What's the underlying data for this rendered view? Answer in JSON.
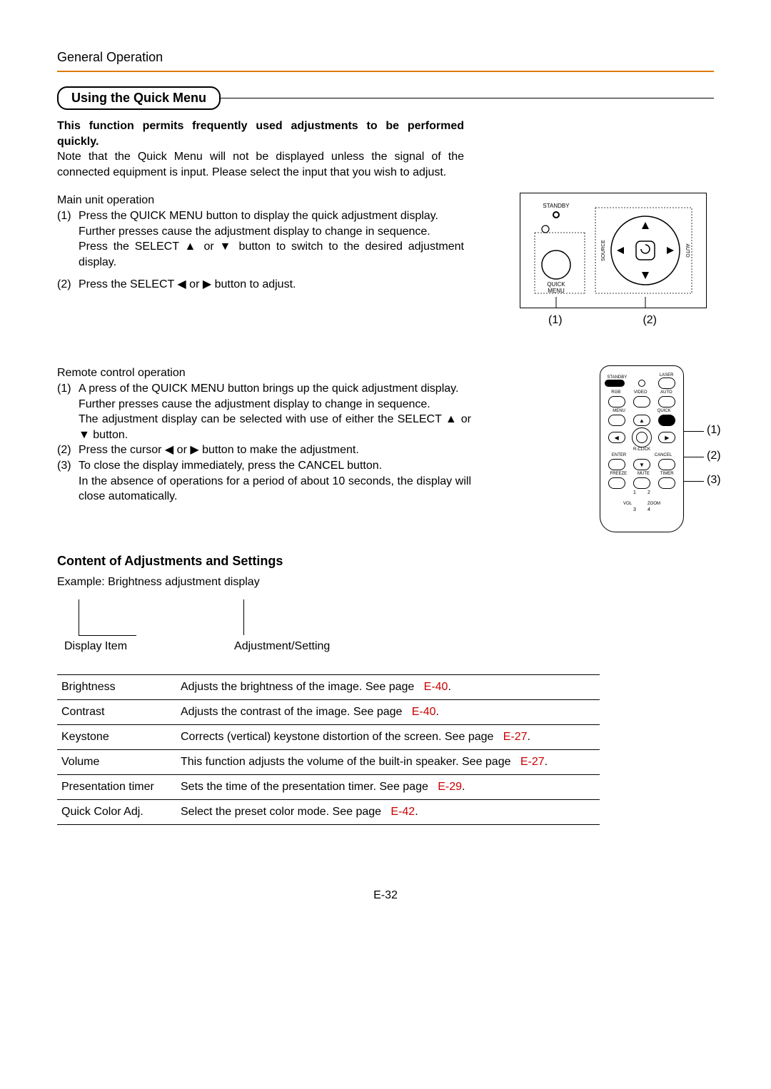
{
  "header": {
    "title": "General Operation"
  },
  "section": {
    "title": "Using the Quick Menu"
  },
  "intro": {
    "bold": "This function permits frequently used adjustments to be performed quickly.",
    "note": "Note that the Quick Menu will not be displayed unless the signal of the connected equipment is input. Please select the input that you wish to adjust."
  },
  "mainUnit": {
    "heading": "Main unit operation",
    "item1_num": "(1)",
    "item1a": "Press the QUICK MENU button to display the quick adjustment display.",
    "item1b": "Further presses cause the adjustment display to change in sequence.",
    "item1c": "Press the SELECT ▲ or ▼ button to switch to the desired adjustment display.",
    "item2_num": "(2)",
    "item2": "Press the SELECT  ◀ or ▶ button to adjust.",
    "legend1": "(1)",
    "legend2": "(2)"
  },
  "unitDiag": {
    "standby": "STANDBY",
    "quick": "QUICK",
    "menu": "MENU",
    "source": "SOURCE",
    "auto": "AUTO"
  },
  "remoteOp": {
    "heading": "Remote control operation",
    "item1_num": "(1)",
    "item1a": "A press of the QUICK MENU button brings up the quick adjustment display.",
    "item1b": "Further presses cause the adjustment display to change in sequence.",
    "item1c": "The adjustment display can be selected with use of either the SELECT ▲ or ▼ button.",
    "item2_num": "(2)",
    "item2": "Press the cursor   ◀ or ▶ button to make the adjustment.",
    "item3_num": "(3)",
    "item3a": "To close the display immediately, press the CANCEL button.",
    "item3b": "In the absence of operations for a period of about 10 seconds, the display will close automatically.",
    "mark1": "(1)",
    "mark2": "(2)",
    "mark3": "(3)"
  },
  "remoteLabels": {
    "standby": "STANDBY",
    "laser": "LASER",
    "rgb": "RGB",
    "video": "VIDEO",
    "auto": "AUTO",
    "menu": "MENU",
    "quick": "QUICK",
    "rclick": "R-CLICK",
    "enter": "ENTER",
    "cancel": "CANCEL",
    "freeze": "FREEZE",
    "mute": "MUTE",
    "timer": "TIMER",
    "vol": "VOL",
    "zoom": "ZOOM",
    "n1": "1",
    "n2": "2",
    "n3": "3",
    "n4": "4"
  },
  "content": {
    "heading": "Content of Adjustments and Settings",
    "example": "Example: Brightness adjustment display",
    "displayItem": "Display Item",
    "adjSetting": "Adjustment/Setting"
  },
  "table": {
    "r1i": "Brightness",
    "r1d": "Adjusts the brightness of the image. See page ",
    "r1p": "E-40",
    "r1s": ".",
    "r2i": "Contrast",
    "r2d": "Adjusts the contrast of the image. See page ",
    "r2p": "E-40",
    "r2s": ".",
    "r3i": "Keystone",
    "r3d": "Corrects (vertical) keystone distortion of the screen.  See page ",
    "r3p": "E-27",
    "r3s": ".",
    "r4i": "Volume",
    "r4d": "This function adjusts the volume of the built-in speaker. See page ",
    "r4p": "E-27",
    "r4s": ".",
    "r5i": "Presentation timer",
    "r5d": "Sets the time of the presentation timer.  See page ",
    "r5p": "E-29",
    "r5s": ".",
    "r6i": "Quick Color Adj.",
    "r6d": "Select the preset color mode. See page ",
    "r6p": "E-42",
    "r6s": "."
  },
  "page": {
    "num": "E-32"
  }
}
